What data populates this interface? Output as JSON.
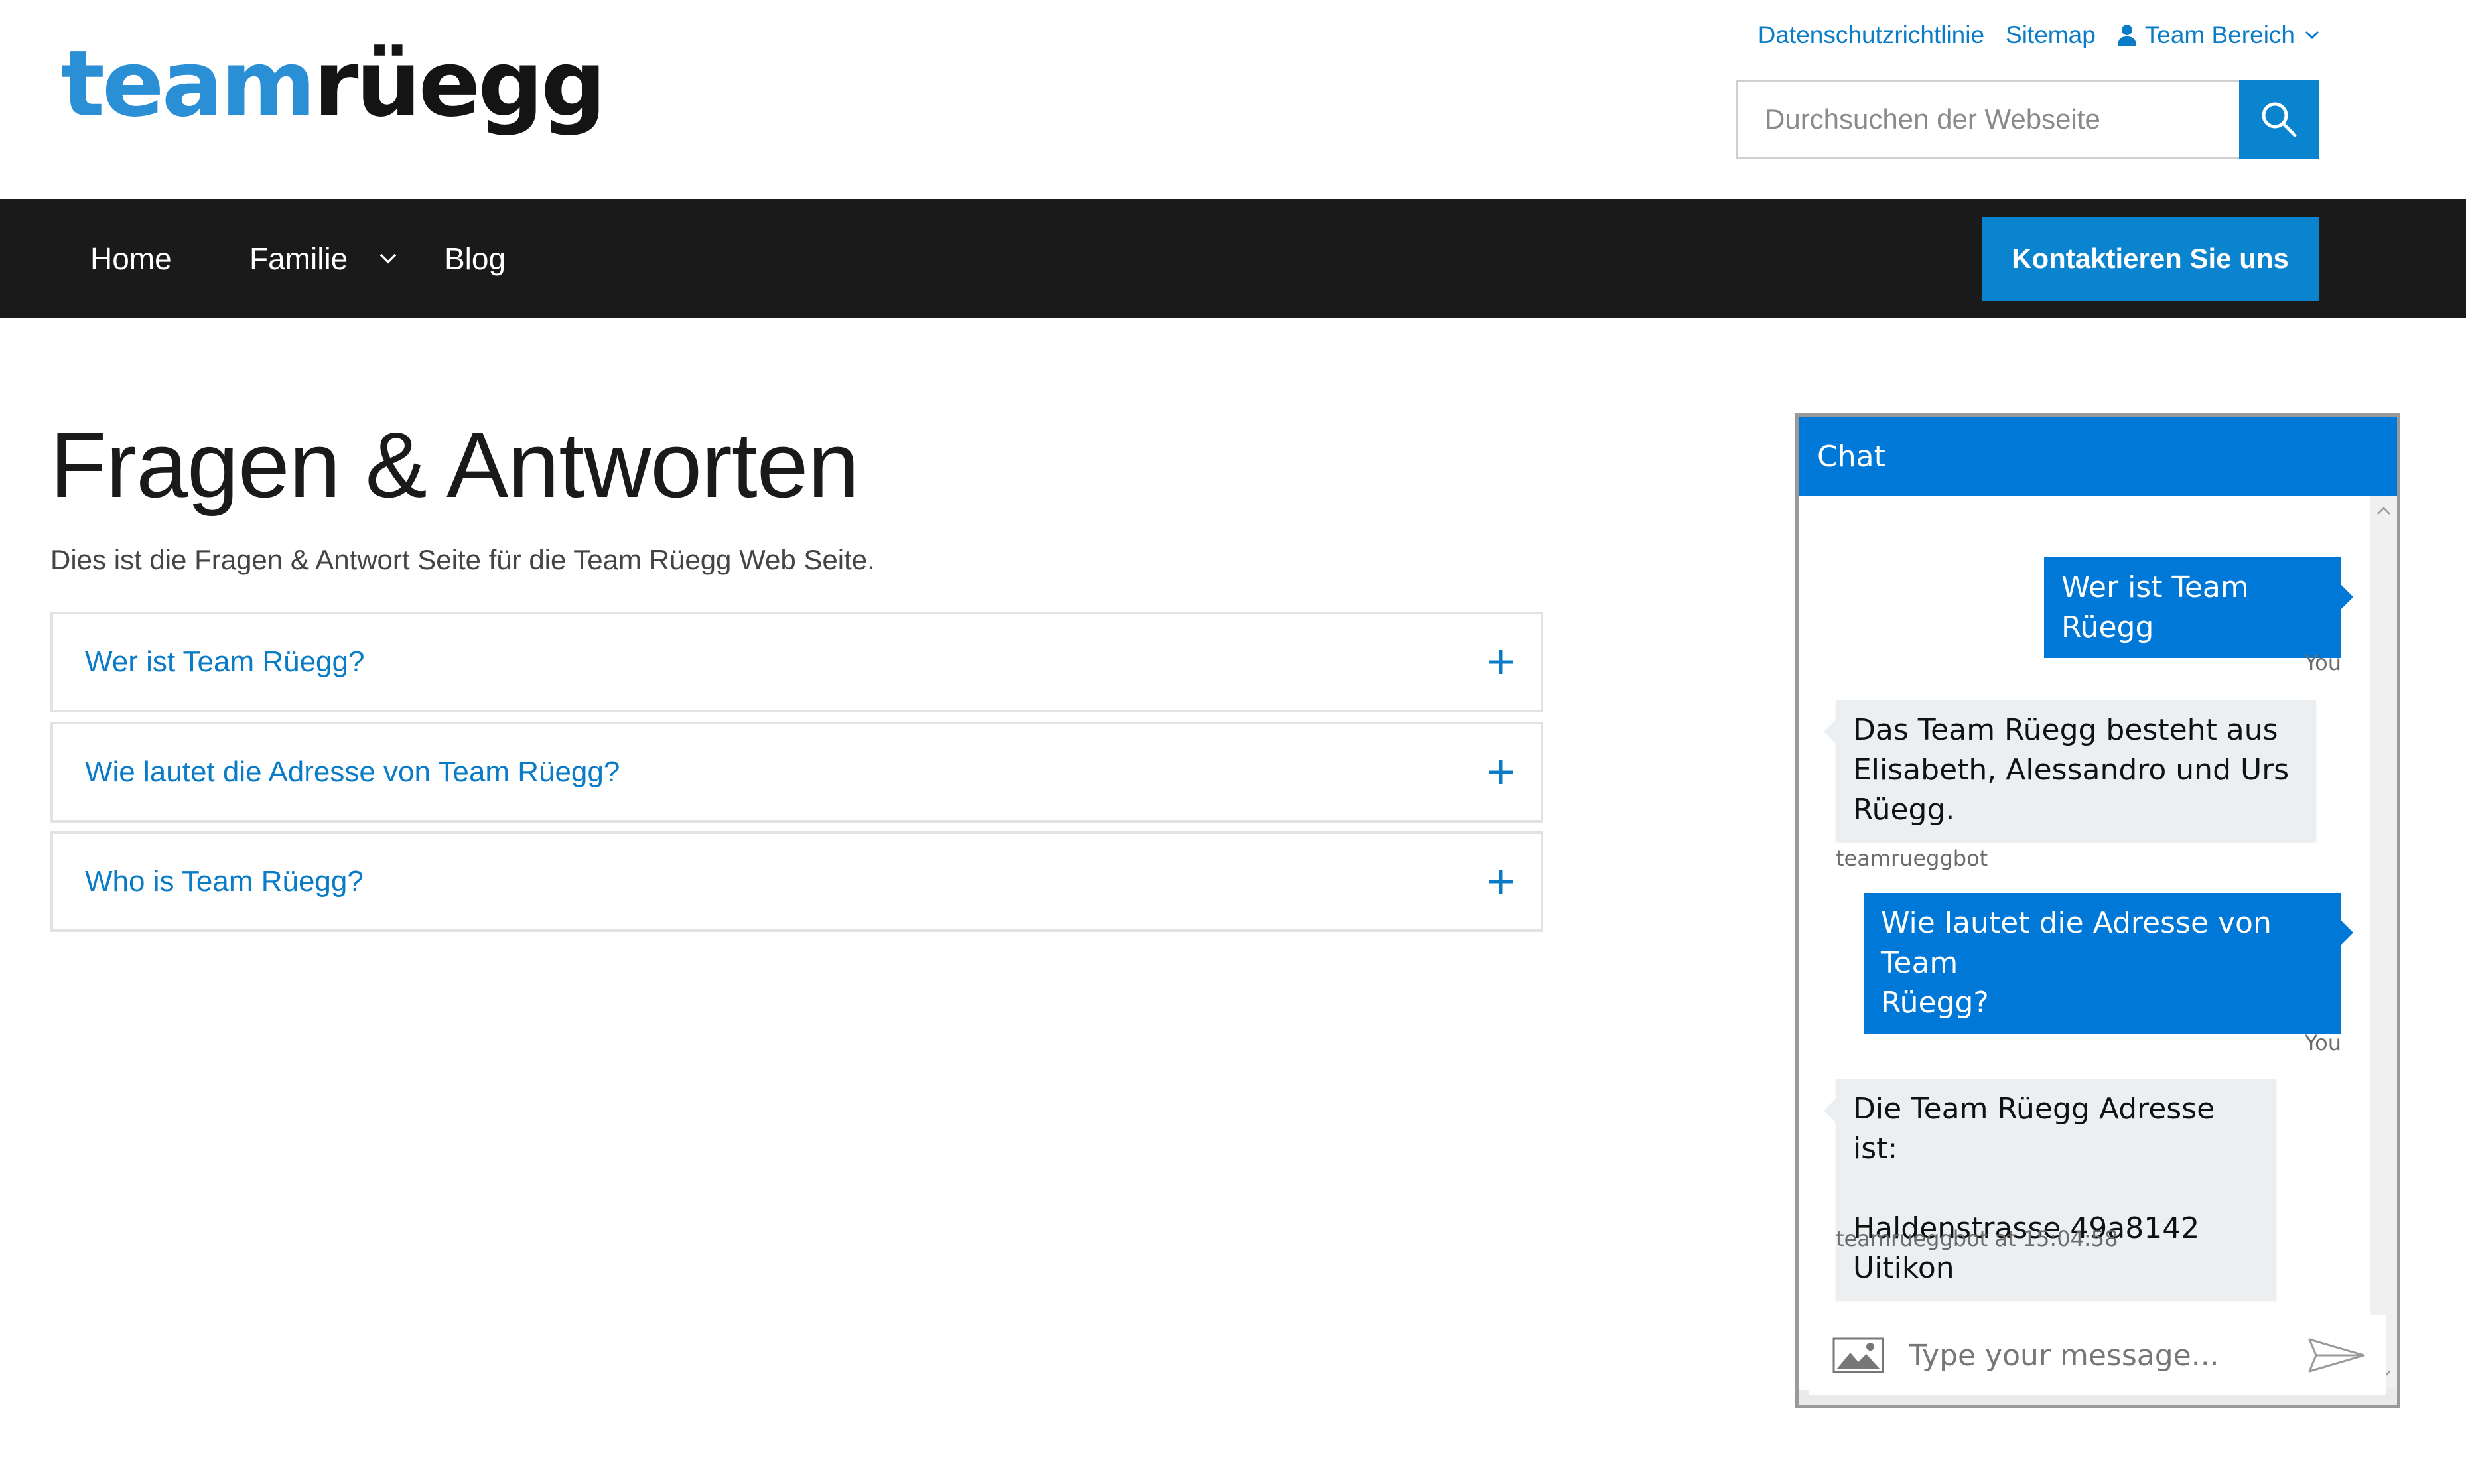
{
  "logo": {
    "part1": "team",
    "part2": "rüegg"
  },
  "toplinks": {
    "privacy": "Datenschutzrichtlinie",
    "sitemap": "Sitemap",
    "team_area": "Team Bereich"
  },
  "search": {
    "placeholder": "Durchsuchen der Webseite"
  },
  "nav": {
    "items": [
      {
        "label": "Home"
      },
      {
        "label": "Familie"
      },
      {
        "label": "Blog"
      }
    ],
    "contact_button": "Kontaktieren Sie uns"
  },
  "page": {
    "title": "Fragen & Antworten",
    "description": "Dies ist die Fragen & Antwort Seite für die Team Rüegg Web Seite."
  },
  "faq": [
    {
      "question": "Wer ist Team Rüegg?"
    },
    {
      "question": "Wie lautet die Adresse von Team Rüegg?"
    },
    {
      "question": "Who is Team Rüegg?"
    }
  ],
  "chat": {
    "title": "Chat",
    "messages": [
      {
        "from": "user",
        "text": "Wer ist Team Rüegg",
        "meta": "You"
      },
      {
        "from": "bot",
        "text_lines": [
          "Das Team Rüegg besteht aus",
          "Elisabeth, Alessandro und Urs",
          "Rüegg."
        ],
        "meta": "teamrueggbot"
      },
      {
        "from": "user",
        "text_lines": [
          "Wie lautet die Adresse von Team",
          "Rüegg?"
        ],
        "meta": "You"
      },
      {
        "from": "bot",
        "text_lines": [
          "Die Team Rüegg Adresse ist:",
          "Haldenstrasse 49a8142 Uitikon"
        ],
        "meta": "teamrueggbot at 15:04:58"
      }
    ],
    "input_placeholder": "Type your message..."
  },
  "colors": {
    "brand_blue": "#0b84cf",
    "chat_blue": "#0078d7",
    "nav_bg": "#1a1a1a",
    "link_blue": "#0a7cc7"
  }
}
